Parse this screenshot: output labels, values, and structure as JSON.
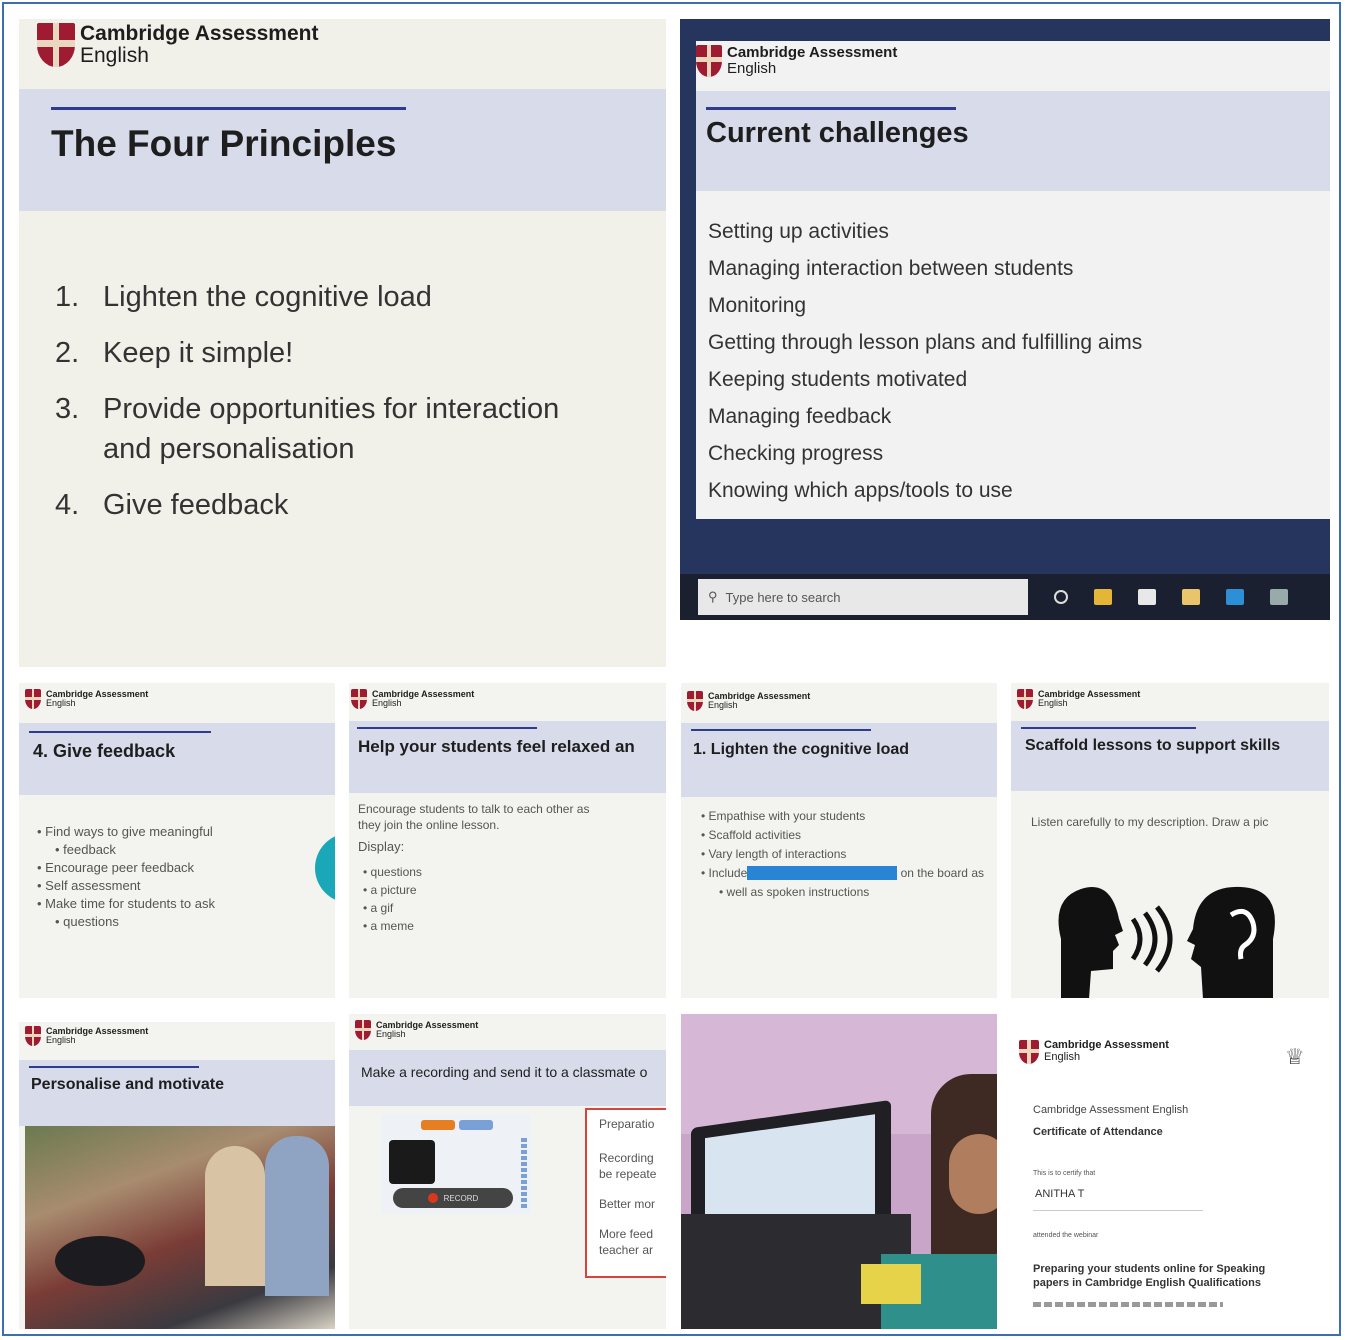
{
  "logo": {
    "line1": "Cambridge Assessment",
    "line2": "English"
  },
  "slides": {
    "four_principles": {
      "title": "The Four Principles",
      "items": [
        {
          "num": "1.",
          "text": "Lighten the cognitive load"
        },
        {
          "num": "2.",
          "text": "Keep it simple!"
        },
        {
          "num": "3.",
          "text": "Provide opportunities for interaction",
          "text2": "and personalisation"
        },
        {
          "num": "4.",
          "text": "Give feedback"
        }
      ]
    },
    "challenges": {
      "title": "Current challenges",
      "items": [
        "Setting up activities",
        "Managing interaction between students",
        "Monitoring",
        "Getting through lesson plans and fulfilling aims",
        "Keeping students motivated",
        "Managing feedback",
        "Checking progress",
        "Knowing which apps/tools to use"
      ],
      "taskbar_search": "Type here to search"
    },
    "give_feedback": {
      "title": "4. Give feedback",
      "items": [
        "Find ways to give meaningful",
        "feedback",
        "Encourage peer feedback",
        "Self assessment",
        "Make time for students to ask",
        "questions"
      ]
    },
    "relaxed": {
      "title": "Help your students feel relaxed an",
      "intro1": "Encourage students to talk to each other as",
      "intro2": "they join the online lesson.",
      "display_label": "Display:",
      "items": [
        "questions",
        "a picture",
        "a gif",
        "a meme"
      ]
    },
    "lighten": {
      "title": "1. Lighten the cognitive load",
      "items": [
        "Empathise with your students",
        "Scaffold activities",
        "Vary length of interactions"
      ],
      "include_pre": "Include",
      "include_post": "on the board as",
      "include_line2": "well as spoken instructions"
    },
    "scaffold": {
      "title": "Scaffold lessons to support skills",
      "text": "Listen carefully to my description.  Draw a pic"
    },
    "personalise": {
      "title": "Personalise and motivate"
    },
    "recording": {
      "title": "Make a recording and send it to a classmate o",
      "side_items": [
        "Preparatio",
        "Recording",
        "be repeate",
        "Better mor",
        "More feed",
        "teacher ar"
      ],
      "record_button": "RECORD"
    },
    "certificate": {
      "org": "Cambridge Assessment English",
      "cert_title": "Certificate of Attendance",
      "certify": "This is to certify that",
      "name": "ANITHA T",
      "attended": "attended the webinar",
      "webinar1": "Preparing your students online for Speaking",
      "webinar2": "papers in Cambridge English Qualifications"
    }
  },
  "colors": {
    "frame": "#3b6fb0",
    "brand_red": "#9e1b32",
    "band": "#d7dbea",
    "rule": "#2e3b8f",
    "teal": "#1aa7b8"
  }
}
